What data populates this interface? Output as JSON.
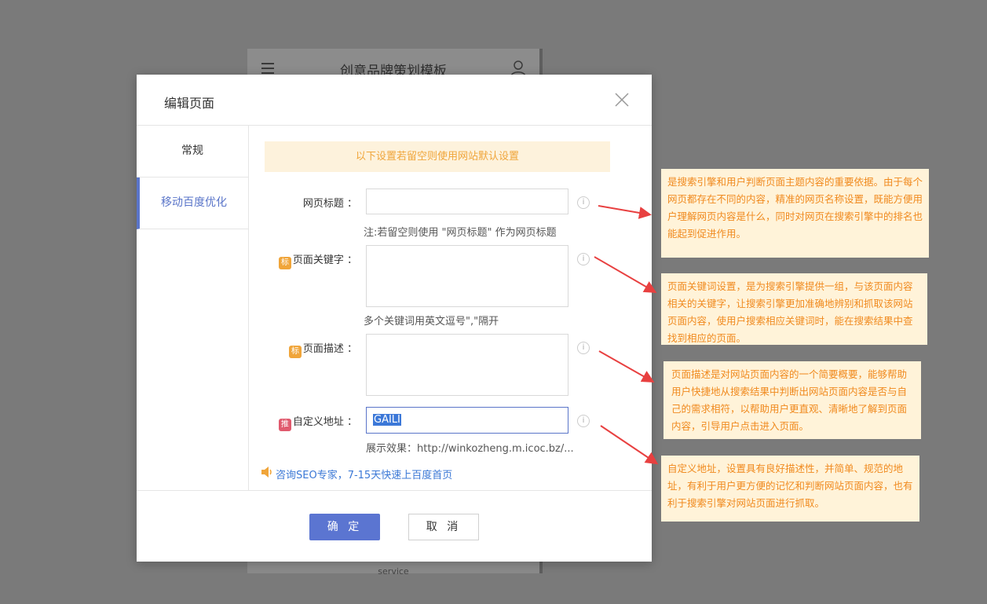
{
  "background_preview": {
    "title": "创意品牌策划模板",
    "footer_text": "service"
  },
  "dialog": {
    "title": "编辑页面",
    "tabs": [
      {
        "label": "常规",
        "active": false
      },
      {
        "label": "移动百度优化",
        "active": true
      }
    ],
    "notice": "以下设置若留空则使用网站默认设置",
    "fields": {
      "page_title": {
        "label": "网页标题 ：",
        "value": "",
        "hint": "注:若留空则使用 \"网页标题\" 作为网页标题"
      },
      "page_keywords": {
        "badge": "标",
        "label": "页面关键字 ：",
        "value": "",
        "hint": "多个关键词用英文逗号\",\"隔开"
      },
      "page_description": {
        "badge": "标",
        "label": "页面描述 ：",
        "value": ""
      },
      "custom_url": {
        "badge": "推",
        "label": "自定义地址 ：",
        "value": "GAILI",
        "hint": "展示效果：http://winkozheng.m.icoc.bz/..."
      }
    },
    "info_icon": "i",
    "seo_link": "咨询SEO专家，7-15天快速上百度首页",
    "ok_label": "确 定",
    "cancel_label": "取 消"
  },
  "annotations": [
    "是搜索引擎和用户判断页面主题内容的重要依据。由于每个网页都存在不同的内容，精准的网页名称设置，既能方便用户理解网页内容是什么，同时对网页在搜索引擎中的排名也能起到促进作用。",
    "页面关键词设置，是为搜索引擎提供一组，与该页面内容相关的关键字，让搜索引擎更加准确地辨别和抓取该网站页面内容，使用户搜索相应关键词时，能在搜索结果中查找到相应的页面。",
    "页面描述是对网站页面内容的一个简要概要，能够帮助用户快捷地从搜索结果中判断出网站页面内容是否与自己的需求相符，以帮助用户更直观、清晰地了解到页面内容，引导用户点击进入页面。",
    "自定义地址，设置具有良好描述性，并简单、规范的地址，有利于用户更方便的记忆和判断网站页面内容，也有利于搜索引擎对网站页面进行抓取。"
  ],
  "colors": {
    "accent": "#5b75d1",
    "notice_bg": "#fdf2dc",
    "annotation_text": "#f08a1e",
    "arrow": "#e84040"
  }
}
